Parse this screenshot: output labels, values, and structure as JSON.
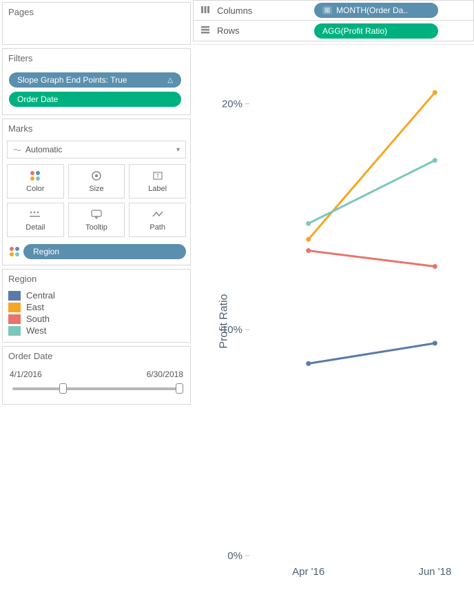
{
  "left": {
    "pages_label": "Pages",
    "filters_label": "Filters",
    "filter_pill_1": "Slope Graph End Points: True",
    "filter_pill_2": "Order Date",
    "marks_label": "Marks",
    "marks_type": "Automatic",
    "mark_btns": {
      "color": "Color",
      "size": "Size",
      "label": "Label",
      "detail": "Detail",
      "tooltip": "Tooltip",
      "path": "Path"
    },
    "region_pill": "Region",
    "legend_title": "Region",
    "legend": {
      "central": "Central",
      "east": "East",
      "south": "South",
      "west": "West"
    },
    "date_title": "Order Date",
    "date_from": "4/1/2016",
    "date_to": "6/30/2018"
  },
  "shelves": {
    "columns_label": "Columns",
    "columns_pill": "MONTH(Order Da..",
    "rows_label": "Rows",
    "rows_pill": "AGG(Profit Ratio)"
  },
  "colors": {
    "central": "#5a7aa8",
    "east": "#f5a623",
    "south": "#e8746b",
    "west": "#7cc7bb"
  },
  "chart_data": {
    "type": "line",
    "ylabel": "Profit Ratio",
    "xlabel": "",
    "ylim": [
      0,
      0.22
    ],
    "yticks": [
      0,
      0.1,
      0.2
    ],
    "ytick_labels": [
      "0%",
      "10%",
      "20%"
    ],
    "categories": [
      "Apr '16",
      "Jun '18"
    ],
    "series": [
      {
        "name": "Central",
        "values": [
          0.085,
          0.094
        ],
        "color": "#5a7aa8"
      },
      {
        "name": "East",
        "values": [
          0.14,
          0.205
        ],
        "color": "#f5a623"
      },
      {
        "name": "South",
        "values": [
          0.135,
          0.128
        ],
        "color": "#e8746b"
      },
      {
        "name": "West",
        "values": [
          0.147,
          0.175
        ],
        "color": "#7cc7bb"
      }
    ]
  }
}
